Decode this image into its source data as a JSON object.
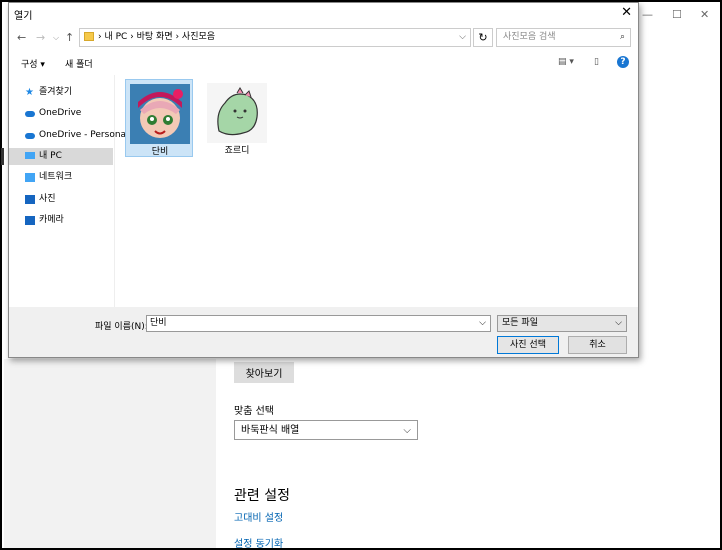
{
  "settings": {
    "browse_button": "찾아보기",
    "fit_label": "맞춤 선택",
    "fit_value": "바둑판식 배열",
    "related_heading": "관련 설정",
    "links": [
      "고대비 설정",
      "설정 동기화"
    ]
  },
  "dialog": {
    "title": "열기",
    "breadcrumbs": "›  내 PC  ›  바탕 화면  ›  사진모음",
    "search_placeholder": "사진모음 검색",
    "toolbar": {
      "organize": "구성 ▾",
      "new_folder": "새 폴더"
    },
    "sidebar": [
      {
        "label": "즐겨찾기",
        "icon": "star-icon",
        "color": "#1e88e5"
      },
      {
        "label": "OneDrive",
        "icon": "cloud-icon",
        "color": "#1976d2"
      },
      {
        "label": "OneDrive - Personal",
        "icon": "cloud-icon",
        "color": "#1976d2"
      },
      {
        "label": "내 PC",
        "icon": "computer-icon",
        "color": "#42a5f5",
        "selected": true
      },
      {
        "label": "네트워크",
        "icon": "network-icon",
        "color": "#42a5f5"
      },
      {
        "label": "사진",
        "icon": "pictures-icon",
        "color": "#1565c0"
      },
      {
        "label": "카메라",
        "icon": "camera-icon",
        "color": "#1565c0"
      }
    ],
    "files": [
      {
        "name": "단비",
        "selected": true
      },
      {
        "name": "죠르디",
        "selected": false
      }
    ],
    "filename_label": "파일 이름(N):",
    "filename_value": "단비",
    "filetype_value": "모든 파일",
    "open_button": "사진 선택",
    "cancel_button": "취소"
  }
}
